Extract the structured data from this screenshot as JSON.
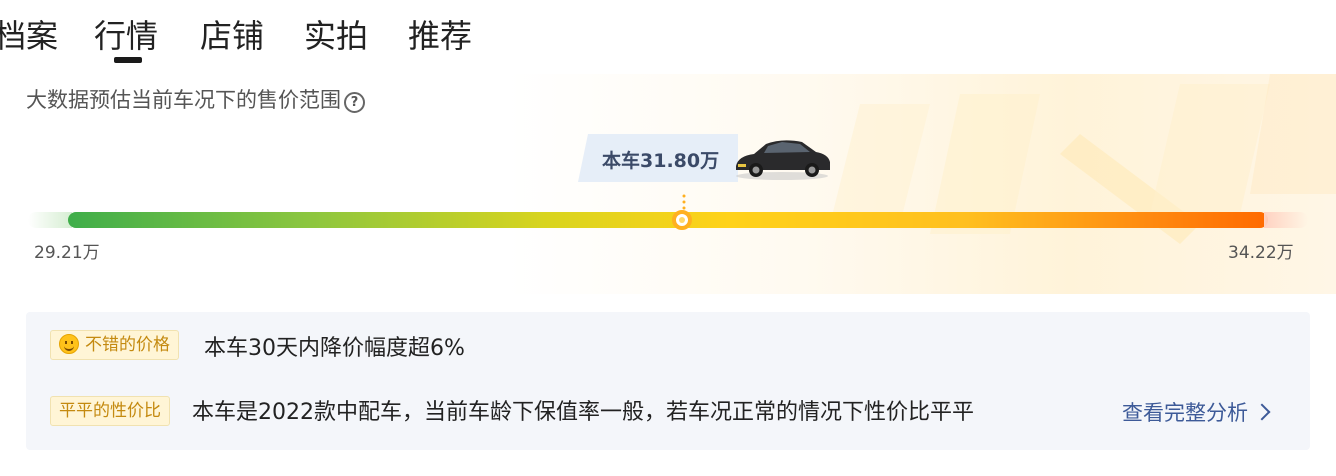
{
  "tabs": [
    {
      "label": "档案"
    },
    {
      "label": "行情"
    },
    {
      "label": "店铺"
    },
    {
      "label": "实拍"
    },
    {
      "label": "推荐"
    }
  ],
  "active_tab": "行情",
  "market": {
    "subtitle": "大数据预估当前车况下的售价范围",
    "help_icon": "question-circle-icon",
    "current_price": "本车31.80万",
    "min_price": "29.21万",
    "max_price": "34.22万",
    "position_fraction": 0.52
  },
  "summary": {
    "tag1": "不错的价格",
    "line1": "本车30天内降价幅度超6%",
    "tag2": "平平的性价比",
    "line2": "本车是2022款中配车，当前车龄下保值率一般，若车况正常的情况下性价比平平",
    "link": "查看完整分析"
  },
  "colors": {
    "bar_start": "#3fae4a",
    "bar_mid": "#ffd21a",
    "bar_end": "#ff6a00",
    "link": "#3d5a98",
    "tag_bg": "#fff5d6",
    "tag_text": "#c48a10"
  }
}
